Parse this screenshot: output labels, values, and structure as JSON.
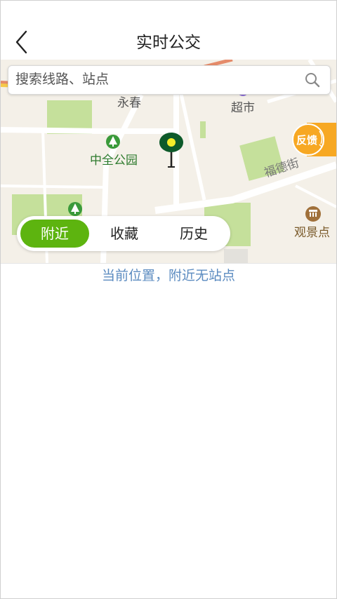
{
  "header": {
    "title": "实时公交",
    "back_icon": "chevron-left-icon"
  },
  "search": {
    "placeholder": "搜索线路、站点",
    "value": "",
    "icon": "search-icon"
  },
  "map": {
    "labels": {
      "yongchun": "永春",
      "supermarket": "超市",
      "park": "中全公园",
      "street": "福德街",
      "scenic": "观景点"
    },
    "feedback_label": "反馈",
    "colors": {
      "park": "#c5e09b",
      "road": "#ffffff",
      "land": "#f4f0e8",
      "accent": "#f7a823",
      "pin": "#0d5a2a"
    }
  },
  "tabs": [
    {
      "label": "附近",
      "active": true
    },
    {
      "label": "收藏",
      "active": false
    },
    {
      "label": "历史",
      "active": false
    }
  ],
  "status": {
    "text": "当前位置，附近无站点"
  },
  "colors": {
    "tab_active": "#5db40f",
    "status_text": "#5b8bc0"
  }
}
